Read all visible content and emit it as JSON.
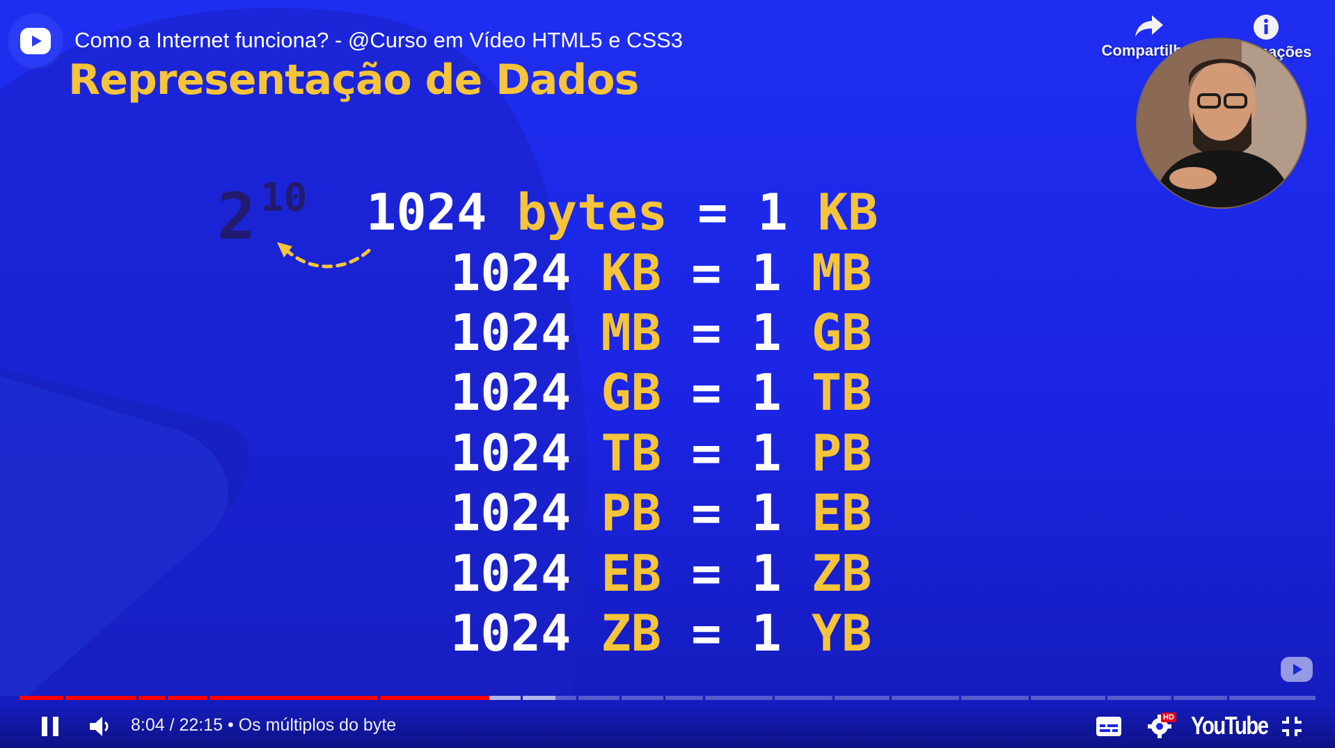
{
  "video": {
    "title": "Como a Internet funciona? - @Curso em Vídeo HTML5 e CSS3",
    "actions": {
      "share_label": "Compartilhar",
      "info_label": "Informações"
    }
  },
  "slide": {
    "heading": "Representação de Dados",
    "power": {
      "base": "2",
      "exponent": "10"
    },
    "rows": [
      {
        "qty": "1024",
        "from": "bytes",
        "eq": "=",
        "one": "1",
        "to": "KB"
      },
      {
        "qty": "1024",
        "from": "KB",
        "eq": "=",
        "one": "1",
        "to": "MB"
      },
      {
        "qty": "1024",
        "from": "MB",
        "eq": "=",
        "one": "1",
        "to": "GB"
      },
      {
        "qty": "1024",
        "from": "GB",
        "eq": "=",
        "one": "1",
        "to": "TB"
      },
      {
        "qty": "1024",
        "from": "TB",
        "eq": "=",
        "one": "1",
        "to": "PB"
      },
      {
        "qty": "1024",
        "from": "PB",
        "eq": "=",
        "one": "1",
        "to": "EB"
      },
      {
        "qty": "1024",
        "from": "EB",
        "eq": "=",
        "one": "1",
        "to": "ZB"
      },
      {
        "qty": "1024",
        "from": "ZB",
        "eq": "=",
        "one": "1",
        "to": "YB"
      }
    ]
  },
  "player": {
    "time_text": "8:04 / 22:15 • Os múltiplos do byte",
    "current_time": "8:04",
    "duration": "22:15",
    "chapter": "Os múltiplos do byte",
    "played_fraction": 0.3627,
    "buffered_fraction": 0.4135,
    "hd_badge": "HD",
    "brand": "YouTube",
    "icons": [
      "pause-icon",
      "volume-icon",
      "subtitles-icon",
      "settings-icon",
      "youtube-logo",
      "exit-fullscreen-icon",
      "share-icon",
      "info-icon"
    ]
  },
  "colors": {
    "accent_yellow": "#f5c43a",
    "progress_red": "#ff0000",
    "background_blue": "#1e2ef0"
  }
}
